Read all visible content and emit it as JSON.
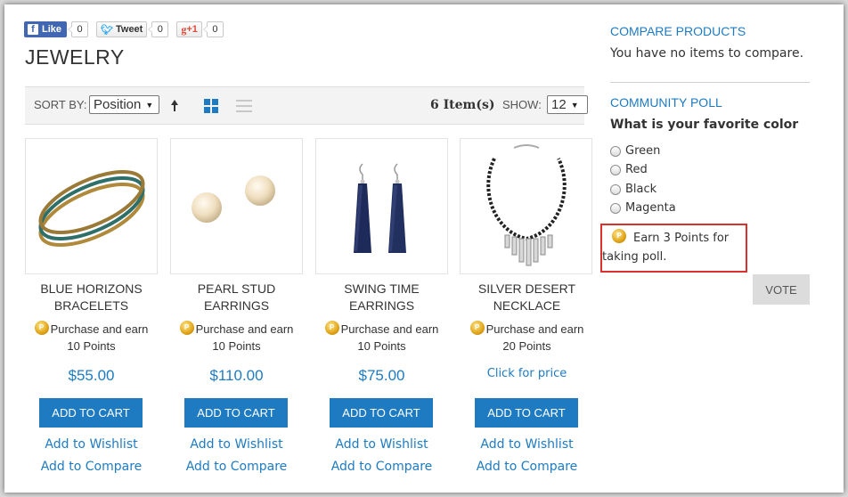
{
  "social": {
    "like_label": "Like",
    "like_count": "0",
    "tweet_label": "Tweet",
    "tweet_count": "0",
    "gplus_label": "+1",
    "gplus_count": "0"
  },
  "page_title": "JEWELRY",
  "toolbar": {
    "sort_label": "SORT BY:",
    "sort_value": "Position",
    "item_count": "6 Item(s)",
    "show_label": "SHOW:",
    "show_value": "12"
  },
  "products": [
    {
      "name_line1": "BLUE HORIZONS",
      "name_line2": "BRACELETS",
      "earn_line1": "Purchase and earn",
      "earn_line2": "10 Points",
      "price": "$55.00",
      "add_to_cart": "ADD TO CART",
      "wishlist": "Add to Wishlist",
      "compare": "Add to Compare"
    },
    {
      "name_line1": "PEARL STUD",
      "name_line2": "EARRINGS",
      "earn_line1": "Purchase and earn",
      "earn_line2": "10 Points",
      "price": "$110.00",
      "add_to_cart": "ADD TO CART",
      "wishlist": "Add to Wishlist",
      "compare": "Add to Compare"
    },
    {
      "name_line1": "SWING TIME",
      "name_line2": "EARRINGS",
      "earn_line1": "Purchase and earn",
      "earn_line2": "10 Points",
      "price": "$75.00",
      "add_to_cart": "ADD TO CART",
      "wishlist": "Add to Wishlist",
      "compare": "Add to Compare"
    },
    {
      "name_line1": "SILVER DESERT",
      "name_line2": "NECKLACE",
      "earn_line1": "Purchase and earn",
      "earn_line2": "20 Points",
      "price": "Click for price",
      "add_to_cart": "ADD TO CART",
      "wishlist": "Add to Wishlist",
      "compare": "Add to Compare"
    }
  ],
  "compare": {
    "heading": "COMPARE PRODUCTS",
    "text": "You have no items to compare."
  },
  "poll": {
    "heading": "COMMUNITY POLL",
    "question": "What is your favorite color",
    "options": [
      "Green",
      "Red",
      "Black",
      "Magenta"
    ],
    "earn_line1": "Earn 3 Points for",
    "earn_line2": "taking poll.",
    "vote_label": "VOTE"
  },
  "colors": {
    "accent": "#1e7bc2",
    "highlight_border": "#d9312e"
  }
}
